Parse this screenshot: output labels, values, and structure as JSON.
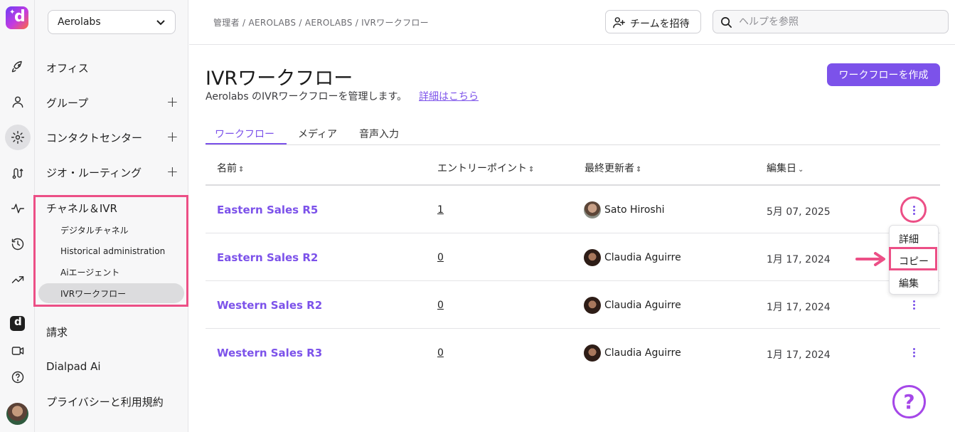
{
  "org_selector": {
    "value": "Aerolabs"
  },
  "breadcrumb": "管理者 / AEROLABS / AEROLABS / IVRワークフロー",
  "header": {
    "invite_label": "チームを招待",
    "search_placeholder": "ヘルプを参照"
  },
  "rail_icons": [
    "rocket-icon",
    "person-icon",
    "gear-icon",
    "route-icon",
    "activity-icon",
    "history-icon",
    "trending-icon",
    "dialpad-icon",
    "video-icon",
    "help-circle-icon"
  ],
  "sidebar": {
    "items": [
      {
        "label": "オフィス"
      },
      {
        "label": "グループ",
        "expandable": true
      },
      {
        "label": "コンタクトセンター",
        "expandable": true
      },
      {
        "label": "ジオ・ルーティング",
        "expandable": true
      },
      {
        "label": "チャネル＆IVR"
      },
      {
        "label": "請求"
      },
      {
        "label": "Dialpad Ai"
      },
      {
        "label": "プライバシーと利用規約"
      }
    ],
    "plus": "+",
    "subitems": [
      {
        "label": "デジタルチャネル"
      },
      {
        "label": "Historical administration"
      },
      {
        "label": "Aiエージェント"
      },
      {
        "label": "IVRワークフロー",
        "active": true
      }
    ]
  },
  "main": {
    "title": "IVRワークフロー",
    "description": "Aerolabs のIVRワークフローを管理します。",
    "learn_more": "詳細はこちら",
    "create_button": "ワークフローを作成",
    "tabs": [
      {
        "label": "ワークフロー",
        "active": true
      },
      {
        "label": "メディア"
      },
      {
        "label": "音声入力"
      }
    ],
    "columns": {
      "name": "名前",
      "entry_point": "エントリーポイント",
      "updated_by": "最終更新者",
      "edited_date": "編集日"
    },
    "rows": [
      {
        "name": "Eastern Sales R5",
        "entry": "1",
        "updated_by": "Sato Hiroshi",
        "date": "5月 07, 2025"
      },
      {
        "name": "Eastern Sales R2",
        "entry": "0",
        "updated_by": "Claudia Aguirre",
        "date": "1月 17, 2024"
      },
      {
        "name": "Western Sales R2",
        "entry": "0",
        "updated_by": "Claudia Aguirre",
        "date": "1月 17, 2024"
      },
      {
        "name": "Western Sales R3",
        "entry": "0",
        "updated_by": "Claudia Aguirre",
        "date": "1月 17, 2024"
      }
    ]
  },
  "context_menu": {
    "items": [
      {
        "label": "詳細"
      },
      {
        "label": "コピー",
        "highlighted": true
      },
      {
        "label": "編集"
      }
    ]
  },
  "colors": {
    "accent": "#7c52ea",
    "annotation": "#ec4f86",
    "help": "#a547e8"
  }
}
